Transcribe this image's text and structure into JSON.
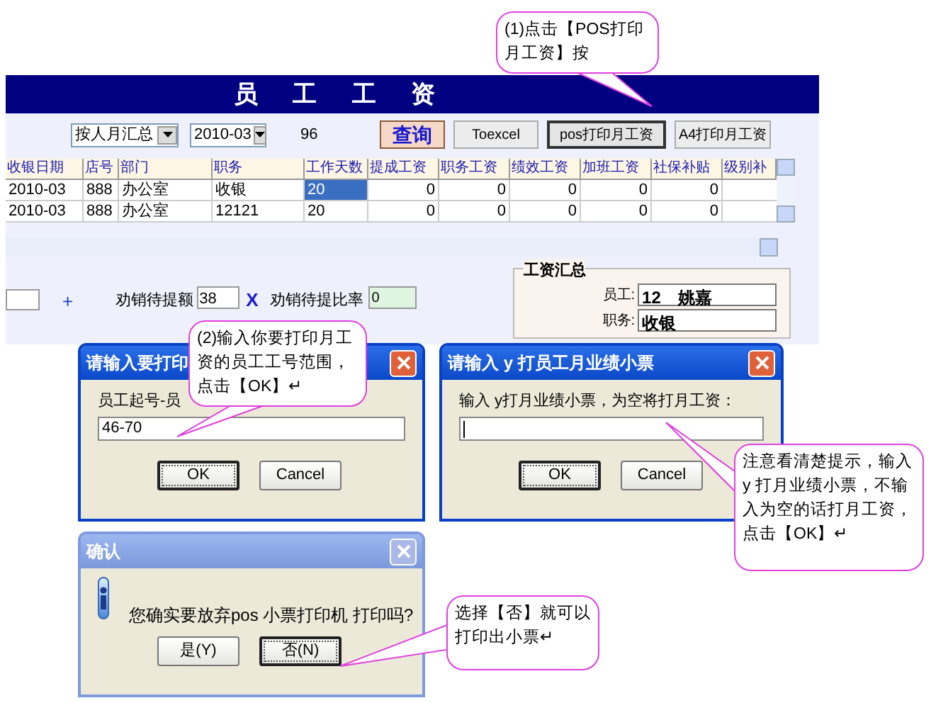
{
  "salary_window": {
    "title": "员 工 工 资",
    "group_by": "按人月汇总",
    "month": "2010-03",
    "count": "96",
    "buttons": [
      {
        "label": "查询",
        "kind": "query"
      },
      {
        "label": "Toexcel",
        "kind": "plain"
      },
      {
        "label": "pos打印月工资",
        "kind": "pressed"
      },
      {
        "label": "A4打印月工资",
        "kind": "plain"
      }
    ],
    "table": {
      "columns": [
        {
          "label": "收银日期",
          "kind": "text"
        },
        {
          "label": "店号",
          "kind": "text"
        },
        {
          "label": "部门",
          "kind": "text"
        },
        {
          "label": "职务",
          "kind": "text"
        },
        {
          "label": "工作天数",
          "kind": "text"
        },
        {
          "label": "提成工资",
          "kind": "number"
        },
        {
          "label": "职务工资",
          "kind": "number"
        },
        {
          "label": "绩效工资",
          "kind": "number"
        },
        {
          "label": "加班工资",
          "kind": "number"
        },
        {
          "label": "社保补贴",
          "kind": "number"
        },
        {
          "label": "级别补"
        }
      ],
      "rows": [
        {
          "cells": [
            {
              "text": "2010-03",
              "selected": false
            },
            {
              "text": "888",
              "selected": false
            },
            {
              "text": "办公室",
              "selected": false
            },
            {
              "text": "收银",
              "selected": false
            },
            {
              "text": "20",
              "selected": true
            },
            {
              "text": "0",
              "selected": false
            },
            {
              "text": "0",
              "selected": false
            },
            {
              "text": "0",
              "selected": false
            },
            {
              "text": "0",
              "selected": false
            },
            {
              "text": "0",
              "selected": false
            }
          ]
        },
        {
          "cells": [
            {
              "text": "2010-03",
              "selected": false
            },
            {
              "text": "888",
              "selected": false
            },
            {
              "text": "办公室",
              "selected": false
            },
            {
              "text": "12121",
              "selected": false
            },
            {
              "text": "20",
              "selected": false
            },
            {
              "text": "0",
              "selected": false
            },
            {
              "text": "0",
              "selected": false
            },
            {
              "text": "0",
              "selected": false
            },
            {
              "text": "0",
              "selected": false
            },
            {
              "text": "0",
              "selected": false
            }
          ]
        }
      ]
    },
    "commission": {
      "plus": "+",
      "amount_label": "劝销待提额",
      "amount": "38",
      "operator": "X",
      "rate_label": "劝销待提比率",
      "rate": "0"
    },
    "salary_summary": {
      "title": "工资汇总",
      "fields": [
        {
          "label": "员工:",
          "value": "12　姚嘉"
        },
        {
          "label": "职务:",
          "value": "收银"
        }
      ]
    }
  },
  "dialogs": [
    {
      "kind": "input",
      "active": true,
      "title": "请输入要打印",
      "prompt": "员工起号-员",
      "value": "46-70",
      "buttons": [
        {
          "label": "OK",
          "focused": true
        },
        {
          "label": "Cancel",
          "focused": false
        }
      ]
    },
    {
      "kind": "input",
      "active": true,
      "title": "请输入 y 打员工月业绩小票",
      "prompt": "输入 y打月业绩小票，为空将打月工资：",
      "buttons": [
        {
          "label": "OK",
          "focused": true
        },
        {
          "label": "Cancel",
          "focused": false
        }
      ]
    },
    {
      "kind": "confirm",
      "active": false,
      "title": "确认",
      "message": "您确实要放弃pos 小票打印机 打印吗?",
      "buttons": [
        {
          "label": "是(Y)",
          "focused": false
        },
        {
          "label": "否(N)",
          "focused": true
        }
      ]
    }
  ],
  "callouts": [
    {
      "text": "(1)点击【POS打印月工资】按"
    },
    {
      "text": "(2)输入你要打印月工资的员工工号范围，点击【OK】↵"
    },
    {
      "text": "注意看清楚提示，输入 y 打月业绩小票，不输入为空的话打月工资，点击【OK】↵"
    },
    {
      "text": "选择【否】就可以打印出小票↵"
    }
  ]
}
